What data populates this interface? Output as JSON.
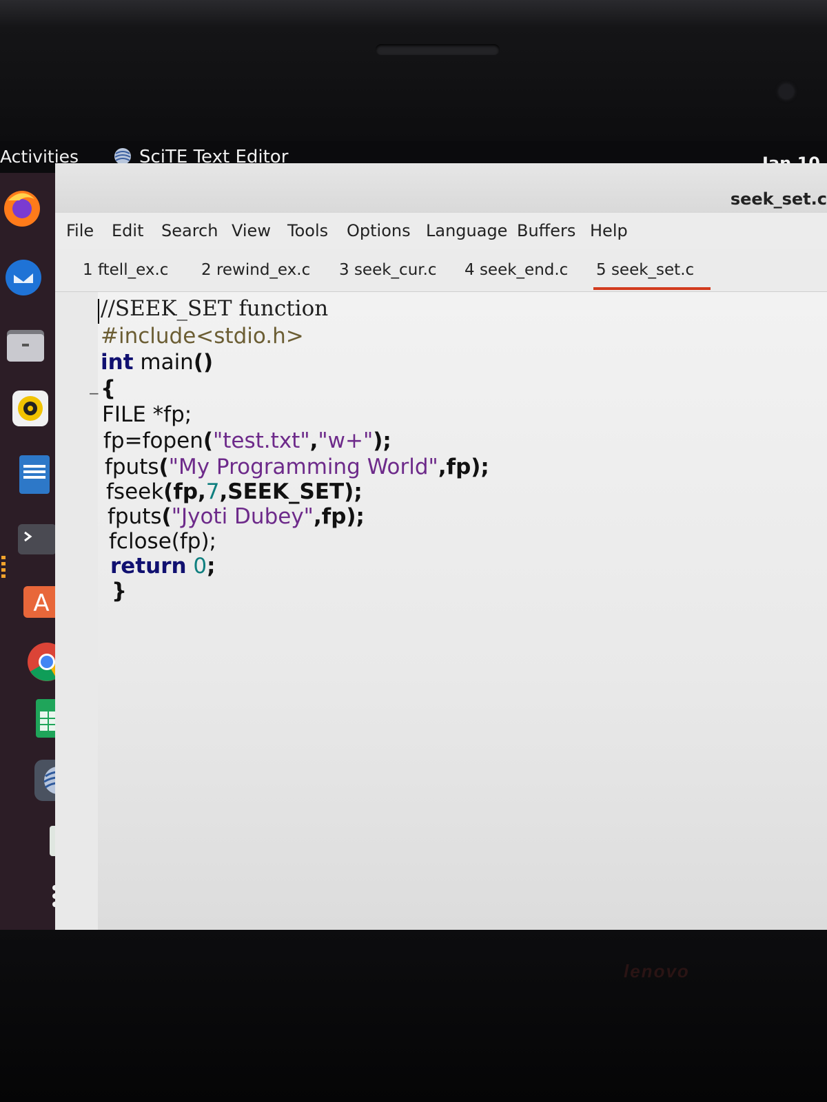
{
  "topbar": {
    "activities": "Activities",
    "app_name": "SciTE Text Editor",
    "clock": "Jan 10"
  },
  "dock": {
    "icons": [
      "firefox-icon",
      "thunderbird-icon",
      "files-icon",
      "rhythmbox-icon",
      "libreoffice-writer-icon",
      "terminal-icon",
      "software-center-icon",
      "chrome-icon",
      "libreoffice-calc-icon",
      "scite-icon",
      "trash-icon",
      "show-apps-icon"
    ]
  },
  "window": {
    "title": "seek_set.c"
  },
  "menu": [
    "File",
    "Edit",
    "Search",
    "View",
    "Tools",
    "Options",
    "Language",
    "Buffers",
    "Help"
  ],
  "tabs": [
    {
      "label": "1 ftell_ex.c"
    },
    {
      "label": "2 rewind_ex.c"
    },
    {
      "label": "3 seek_cur.c"
    },
    {
      "label": "4 seek_end.c"
    },
    {
      "label": "5 seek_set.c",
      "active": true
    }
  ],
  "code": {
    "comment": "//SEEK_SET function",
    "include": "#include<stdio.h>",
    "main_kw": "int",
    "main_name": "main",
    "main_parens": "()",
    "open_brace": "{",
    "l4": "FILE *fp;",
    "l5_a": "fp=fopen",
    "l5_b": "(",
    "l5_c": "\"test.txt\"",
    "l5_d": ",",
    "l5_e": "\"w+\"",
    "l5_f": ");",
    "l6_a": "fputs",
    "l6_b": "(",
    "l6_c": "\"My Programming World\"",
    "l6_d": ",fp);",
    "l7_a": "fseek",
    "l7_b": "(fp,",
    "l7_c": "7",
    "l7_d": ",SEEK_SET);",
    "l8_a": "fputs",
    "l8_b": "(",
    "l8_c": "\"Jyoti Dubey\"",
    "l8_d": ",fp);",
    "l9": "fclose(fp);",
    "l10_kw": "return",
    "l10_num": "0",
    "l10_end": ";",
    "close_brace": "}"
  },
  "colors": {
    "accent_tab_underline": "#d23b1e",
    "keyword": "#101070",
    "string": "#6d2a8a",
    "number": "#0f7f7f",
    "dock_bg": "#2c1d26"
  },
  "brand": "lenovo"
}
